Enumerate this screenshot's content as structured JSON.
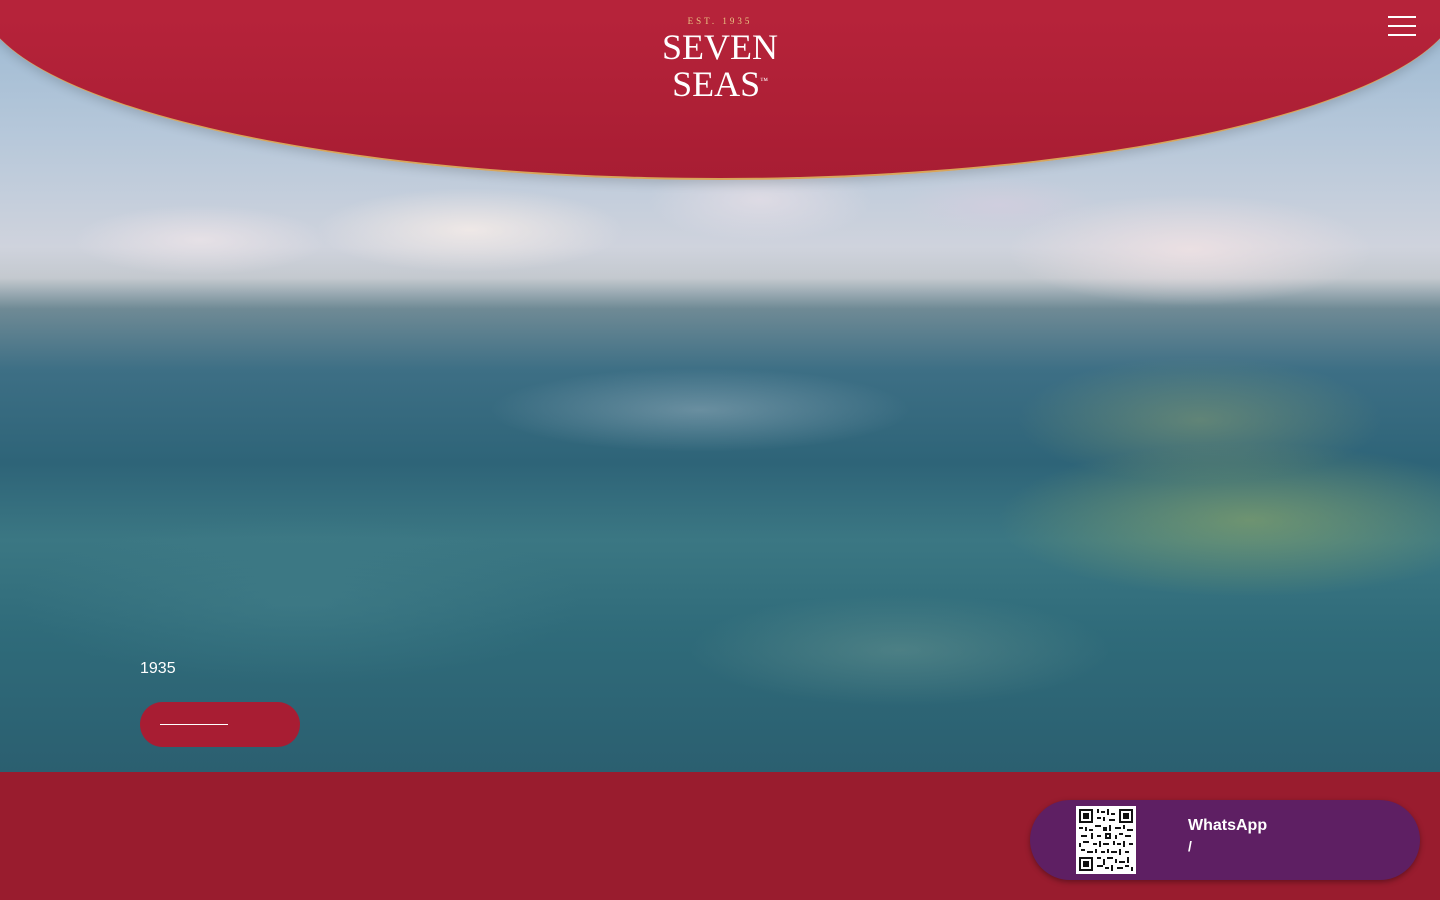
{
  "brand": {
    "est": "EST. 1935",
    "name_line1": "SEVEN",
    "name_line2": "SEAS",
    "trademark": "™"
  },
  "header": {
    "menu_icon": "hamburger-menu-icon"
  },
  "hero": {
    "title": "",
    "subtitle_prefix": "",
    "subtitle_year": "1935",
    "cta_label": ""
  },
  "section": {
    "title": ""
  },
  "whatsapp_widget": {
    "line1_prefix": "",
    "line1_brand": "WhatsApp",
    "line2_sep": "/",
    "qr_icon": "qr-code-icon"
  },
  "colors": {
    "brand_red": "#b6233a",
    "section_red": "#991c2e",
    "whatsapp_purple": "#5e1f63",
    "gold_accent": "#d8a55a"
  }
}
